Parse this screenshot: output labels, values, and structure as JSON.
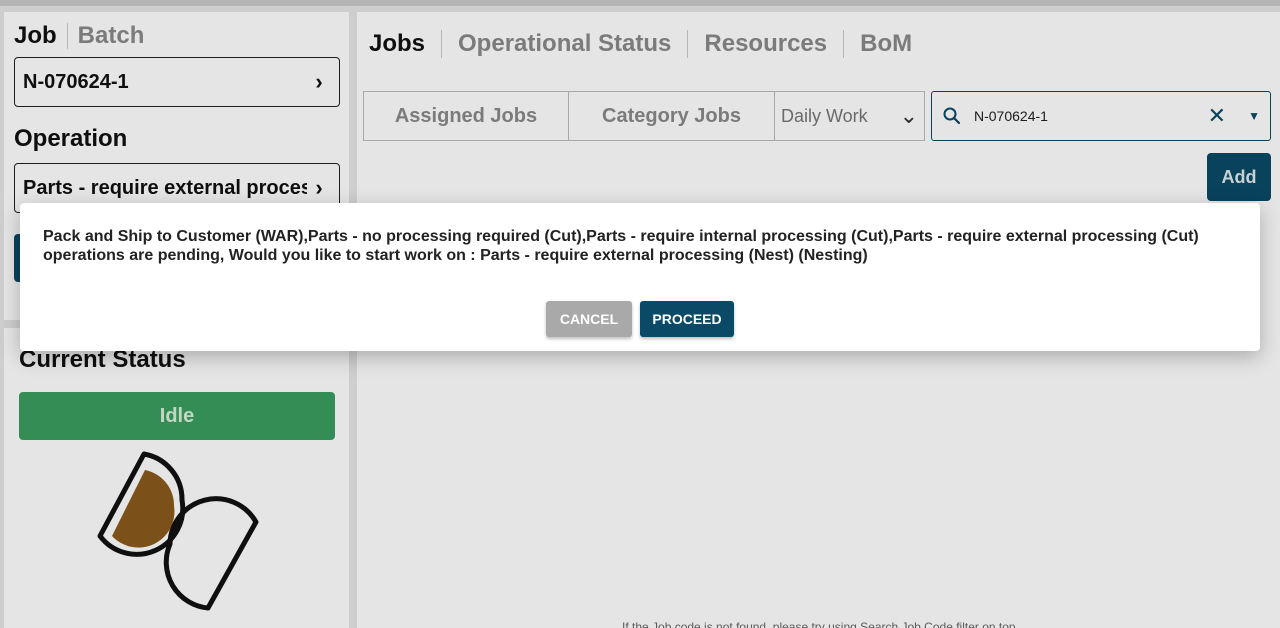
{
  "left": {
    "tabs": {
      "job": "Job",
      "batch": "Batch"
    },
    "job_value": "N-070624-1",
    "operation_label": "Operation",
    "operation_value": "Parts - require external processing (Nest)",
    "current_status_label": "Current Status",
    "status_value": "Idle"
  },
  "main": {
    "tabs": [
      {
        "label": "Jobs"
      },
      {
        "label": "Operational Status"
      },
      {
        "label": "Resources"
      },
      {
        "label": "BoM"
      }
    ],
    "filters": {
      "assigned": "Assigned Jobs",
      "category": "Category Jobs",
      "daily_work": "Daily Work"
    },
    "search_value": "N-070624-1",
    "add_label": "Add",
    "hint": "If the Job code is not found, please try using Search Job Code filter on top"
  },
  "dialog": {
    "message": "Pack and Ship to Customer (WAR),Parts - no processing required (Cut),Parts - require internal processing (Cut),Parts - require external processing (Cut) operations are pending, Would you like to start work on : Parts - require external processing (Nest) (Nesting)",
    "cancel_label": "CANCEL",
    "proceed_label": "PROCEED"
  },
  "colors": {
    "primary": "#0b4a66",
    "status_idle": "#3a9e5f",
    "cancel": "#a9a9a9",
    "hourglass_fill": "#8a5a1c"
  },
  "icons": [
    "chevron-right-icon",
    "search-icon",
    "close-icon",
    "caret-down-icon",
    "hourglass-icon"
  ]
}
